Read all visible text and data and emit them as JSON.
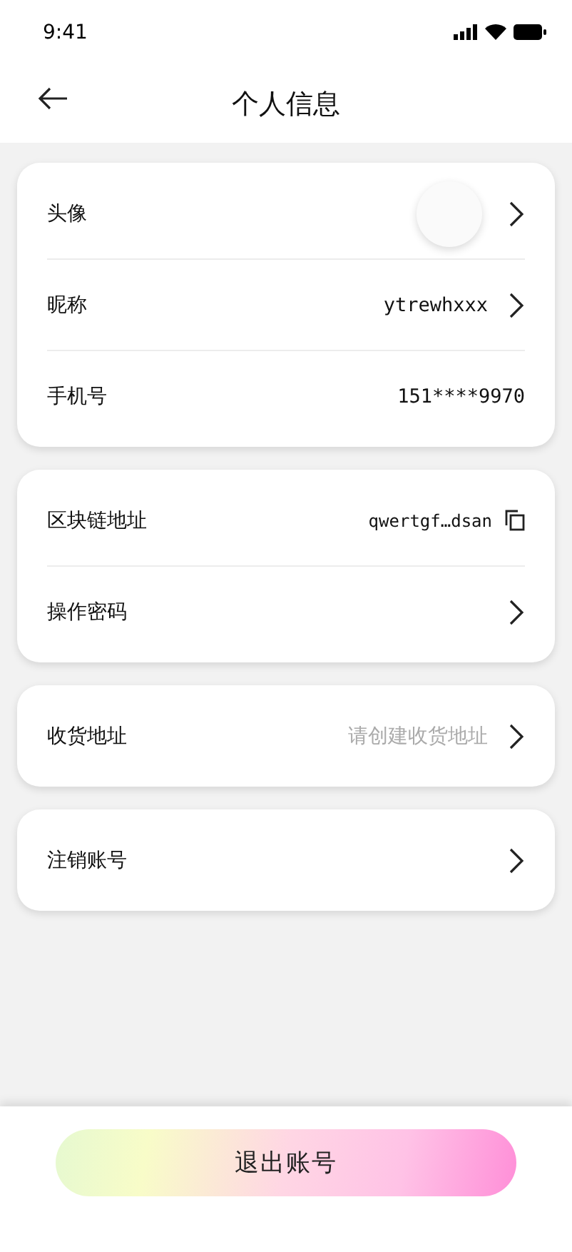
{
  "status_bar": {
    "time": "9:41"
  },
  "header": {
    "title": "个人信息"
  },
  "cards": [
    {
      "rows": [
        {
          "kind": "avatar",
          "label": "头像"
        },
        {
          "kind": "link",
          "label": "昵称",
          "value": "ytrewhxxx"
        },
        {
          "kind": "text",
          "label": "手机号",
          "value": "151****9970"
        }
      ]
    },
    {
      "rows": [
        {
          "kind": "copy",
          "label": "区块链地址",
          "value": "qwertgf…dsan"
        },
        {
          "kind": "link",
          "label": "操作密码"
        }
      ]
    },
    {
      "rows": [
        {
          "kind": "link",
          "label": "收货地址",
          "hint": "请创建收货地址"
        }
      ]
    },
    {
      "rows": [
        {
          "kind": "link",
          "label": "注销账号"
        }
      ]
    }
  ],
  "logout_button": {
    "label": "退出账号"
  }
}
